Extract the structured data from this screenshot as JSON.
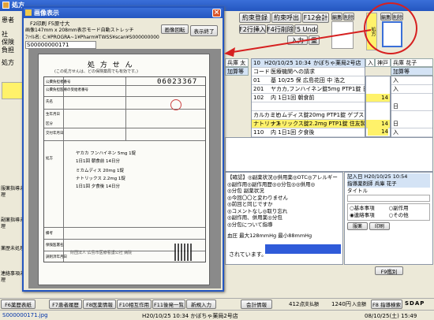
{
  "main_window": {
    "title": "処方",
    "top_buttons": [
      "約束登録",
      "約束呼出",
      "F12会計",
      "F2行挿入",
      "F4行削除",
      "F5 Undo"
    ],
    "left_labels": [
      "患者",
      "社",
      "保険",
      "負担",
      "処方"
    ],
    "thumb_labels": {
      "scan_left": "編集",
      "delete_left": "削除",
      "scan_right": "編集",
      "delete_right": "削除",
      "input": "入力",
      "yellow": "処方",
      "dup": "重"
    },
    "patient_card": {
      "name": "兵庫 太",
      "label": "加算等"
    },
    "right_patient": {
      "name": "兵庫 花子",
      "label": "加算等",
      "tag": "入",
      "area": "神戸"
    },
    "order_header": {
      "no": "10",
      "date": "H20/10/25 10:34",
      "hospital": "かぼちゃ薬局2号店"
    },
    "order_rows": [
      {
        "code": "コード",
        "name": "医療機関への請求"
      },
      {
        "code": "01",
        "name": "基 10/25 保 広島花田 中 浩之"
      },
      {
        "code": "201",
        "name": "ヤカカ,フンハイネン錠5mg PTP1錠 日本薬品"
      },
      {
        "code": "102",
        "name": "内 1日1回 朝食前"
      },
      {
        "code": "",
        "name": ""
      },
      {
        "code": "カルカミヒ",
        "name": "ミカムディス錠20mg PTP1錠 ゲプスタラ製"
      },
      {
        "code": "ナトリッス",
        "name": "ナトリックス錠2.2mg PTP1錠 住友製薬"
      },
      {
        "code": "110",
        "name": "内 1日1回 夕食後"
      }
    ],
    "order_days": [
      "14",
      "",
      "",
      "14",
      "",
      "",
      "14",
      ""
    ],
    "right_lower_rows": [
      "入",
      "入",
      "",
      "日",
      "",
      "日",
      "入",
      "日",
      "日"
    ],
    "notes": {
      "l1": "【確認】◎副薬状況◎併用薬◎OTC◎アレルギー",
      "l2": "◎副作用◎副作用歴◎◎分包◎◎併用◎",
      "l3": "◎分包 副薬状況",
      "l4": "◎今回〇〇と変わりません",
      "l5": "◎前回と同じですか",
      "l6": "◎コメントなし◎取り忘れ",
      "l7": "◎副作用、併用薬◎分包",
      "l8": "◎分包について指導",
      "bp": "血圧 最大128mmHg 最小88mmHg",
      "tail": "されています。"
    },
    "left_notes": [
      "服薬指導未処理",
      "副薬指導未処理",
      "薬歴未処理",
      "連絡事項未処理"
    ],
    "right_panel": {
      "head": "記入日 H20/10/25 10:54",
      "sub": "指導薬剤師 兵庫 花子",
      "title": "タイトル",
      "options": [
        "基本事項",
        "副作用",
        "連絡事項",
        "その他"
      ],
      "btn_a": "服薬",
      "btn_b": "印刷"
    },
    "bottom_buttons": [
      "F6薬歴表紙",
      "F7患者履歴",
      "F8医薬情報",
      "F10相互作用",
      "F11後発一覧",
      "新規入力",
      "会計情報"
    ],
    "money": {
      "a": "412点",
      "a_label": "支払額",
      "b": "1240円",
      "b_label": "入金額"
    },
    "f9_label": "F9鑑別",
    "extra_btn": "F9 鑑別",
    "right_status_btn": "F8 指導検索",
    "tools": "SDAP",
    "status": {
      "file": "S000000171.jpg",
      "center": "H20/10/25 10:34 かぼちゃ薬局2号店",
      "right": "08/10/25(土) 15:49"
    }
  },
  "image_window": {
    "title": "画像表示",
    "size_line": "F2印刷  F5原寸大",
    "size_info": "画像147mm x 208mm表示モード自動ストレッチ",
    "path": "ﾌｧｲﾙ名: C:¥PROGRA~1¥Pharm¥TWSS¥scan¥S000000000171.jpg",
    "id": "S00000000171",
    "btn_rotate": "画像回転",
    "btn_close": "表示終了",
    "paper_title": "処  方  せ  ん",
    "paper_sub": "(この処方せんは、どの保険薬局でも有効です。)",
    "paper_code": "06023367",
    "paper_footer": "財団法人 広島市医療看護公社 病院",
    "paper_rows": [
      "公費負担者番号",
      "公費負担医療の受給者番号",
      "氏名",
      "生年月日",
      "区分",
      "交付年月日",
      "処方",
      "備考",
      "保険医署名",
      "調剤済年月日"
    ],
    "paper_rx": [
      "ヤカカ フンハイネン 5mg 1錠",
      "1日1回 朝食前 14日分",
      "ミカムディス 20mg 1錠",
      "ナトリックス 2.2mg 1錠",
      "1日1回 夕食後 14日分"
    ]
  }
}
